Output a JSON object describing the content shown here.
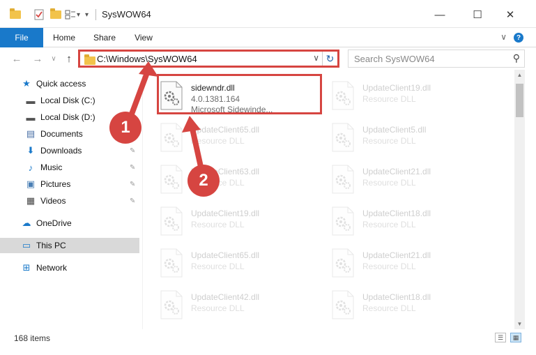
{
  "window": {
    "title": "SysWOW64",
    "minimize_glyph": "—",
    "maximize_glyph": "☐",
    "close_glyph": "✕"
  },
  "quick_access_toolbar": {
    "icons": [
      "folder-icon",
      "properties-check-icon",
      "new-folder-icon",
      "customize-icon"
    ],
    "dropdown_glyph": "▾"
  },
  "ribbon": {
    "tabs": [
      "File",
      "Home",
      "Share",
      "View"
    ],
    "expand_glyph": "∨",
    "help_glyph": "?"
  },
  "navigation": {
    "back_glyph": "←",
    "forward_glyph": "→",
    "recent_glyph": "∨",
    "up_glyph": "↑",
    "address_path": "C:\\Windows\\SysWOW64",
    "address_dropdown_glyph": "∨",
    "refresh_glyph": "↻",
    "search_placeholder": "Search SysWOW64",
    "search_glyph": "⚲"
  },
  "sidebar": {
    "items": [
      {
        "label": "Quick access",
        "icon": "star-icon",
        "glyph": "★",
        "color": "#1979ca",
        "pinned": false
      },
      {
        "label": "Local Disk (C:)",
        "icon": "drive-icon",
        "glyph": "▬",
        "color": "#555555",
        "pinned": false
      },
      {
        "label": "Local Disk (D:)",
        "icon": "drive-icon",
        "glyph": "▬",
        "color": "#555555",
        "pinned": false
      },
      {
        "label": "Documents",
        "icon": "documents-icon",
        "glyph": "▤",
        "color": "#4a6fa5",
        "pinned": true
      },
      {
        "label": "Downloads",
        "icon": "downloads-icon",
        "glyph": "⬇",
        "color": "#1979ca",
        "pinned": true
      },
      {
        "label": "Music",
        "icon": "music-icon",
        "glyph": "♪",
        "color": "#1979ca",
        "pinned": true
      },
      {
        "label": "Pictures",
        "icon": "pictures-icon",
        "glyph": "▣",
        "color": "#4a7fb5",
        "pinned": true
      },
      {
        "label": "Videos",
        "icon": "videos-icon",
        "glyph": "▦",
        "color": "#444444",
        "pinned": true
      },
      {
        "label": "OneDrive",
        "icon": "onedrive-icon",
        "glyph": "☁",
        "color": "#1979ca",
        "pinned": false
      },
      {
        "label": "This PC",
        "icon": "computer-icon",
        "glyph": "▭",
        "color": "#1979ca",
        "pinned": false,
        "selected": true
      },
      {
        "label": "Network",
        "icon": "network-icon",
        "glyph": "⊞",
        "color": "#1979ca",
        "pinned": false
      }
    ],
    "pin_glyph": "📌"
  },
  "files": {
    "highlighted": {
      "name": "sidewndr.dll",
      "version": "4.0.1381.164",
      "description": "Microsoft Sidewinde..."
    },
    "background_tiles": [
      {
        "name": "UpdateClient19.dll",
        "type": "Resource DLL"
      },
      {
        "name": "UpdateClient65.dll",
        "type": "Resource DLL"
      },
      {
        "name": "UpdateClient5.dll",
        "type": "Resource DLL"
      },
      {
        "name": "UpdateClient63.dll",
        "type": "Resource DLL"
      },
      {
        "name": "UpdateClient21.dll",
        "type": "Resource DLL"
      },
      {
        "name": "UpdateClient19.dll",
        "type": "Resource DLL"
      },
      {
        "name": "UpdateClient18.dll",
        "type": "Resource DLL"
      },
      {
        "name": "UpdateClient65.dll",
        "type": "Resource DLL"
      },
      {
        "name": "UpdateClient21.dll",
        "type": "Resource DLL"
      },
      {
        "name": "UpdateClient42.dll",
        "type": "Resource DLL"
      },
      {
        "name": "UpdateClient18.dll",
        "type": "Resource DLL"
      }
    ]
  },
  "scrollbar": {
    "up_glyph": "▲",
    "down_glyph": "▼"
  },
  "status": {
    "item_count": "168 items",
    "details_view_glyph": "☰",
    "tiles_view_glyph": "▦"
  },
  "annotations": {
    "step1": "1",
    "step2": "2",
    "color": "#d64541"
  }
}
